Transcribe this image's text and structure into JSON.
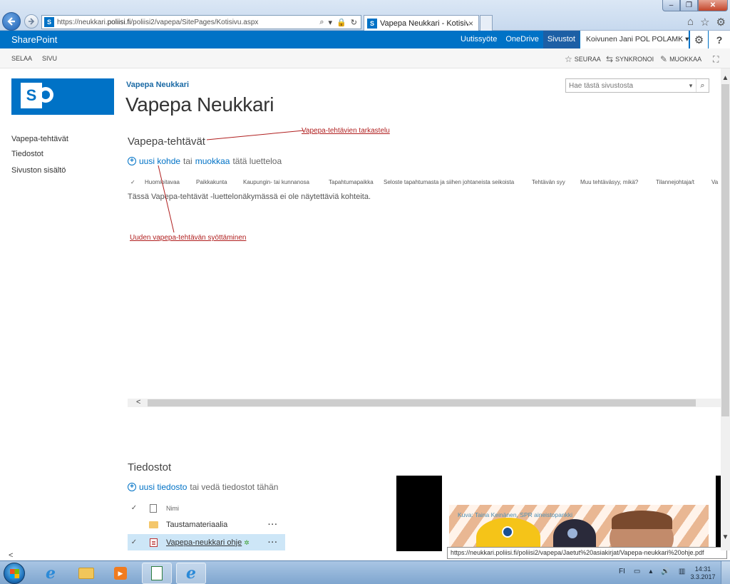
{
  "browser": {
    "url_prefix": "https://neukkari.",
    "url_domain": "poliisi.fi",
    "url_path": "/poliisi2/vapepa/SitePages/Kotisivu.aspx",
    "tab_title": "Vapepa Neukkari - Kotisivu",
    "tab_close": "×",
    "fav_letter": "S",
    "addr_icons": [
      "⌕",
      "▾",
      "🔒",
      "↻"
    ],
    "min_glyph": "–",
    "max_glyph": "❐",
    "close_glyph": "✕",
    "tools": [
      "⌂",
      "☆",
      "⚙"
    ]
  },
  "suite": {
    "brand": "SharePoint",
    "links": [
      "Uutissyöte",
      "OneDrive",
      "Sivustot"
    ],
    "active_link": "Sivustot",
    "user": "Koivunen Jani POL POLAMK ▾",
    "gear": "⚙",
    "help": "?"
  },
  "ribbon": {
    "tabs": [
      "SELAA",
      "SIVU"
    ],
    "follow": "SEURAA",
    "sync": "SYNKRONOI",
    "edit": "MUOKKAA",
    "follow_icon": "☆",
    "sync_icon": "⇆",
    "edit_icon": "✎",
    "focus_icon": "⛶"
  },
  "site": {
    "crumb": "Vapepa Neukkari",
    "title": "Vapepa Neukkari",
    "logo_letter": "S"
  },
  "search": {
    "placeholder": "Hae tästä sivustosta",
    "scope_icon": "▾",
    "button_icon": "⌕"
  },
  "quick_launch": [
    "Vapepa-tehtävät",
    "Tiedostot",
    "Sivuston sisältö"
  ],
  "tasks": {
    "heading": "Vapepa-tehtävät",
    "new_item": "uusi kohde",
    "or": "tai",
    "edit": "muokkaa",
    "edit_suffix": "tätä luetteloa",
    "columns": [
      "Huomioitavaa",
      "Paikkakunta",
      "Kaupungin- tai kunnanosa",
      "Tapahtumapaikka",
      "Seloste tapahtumasta ja siihen johtaneista seikoista",
      "Tehtävän syy",
      "Muu tehtäväsyy, mikä?",
      "Tilannejohtaja/t",
      "Va"
    ],
    "empty_message": "Tässä Vapepa-tehtävät -luettelonäkymässä ei ole näytettäviä kohteita.",
    "check_glyph": "✓"
  },
  "annotations": {
    "view_tasks": "Vapepa-tehtävien tarkastelu",
    "new_task": "Uuden vapepa-tehtävän syöttäminen"
  },
  "files": {
    "heading": "Tiedostot",
    "new_file": "uusi tiedosto",
    "or_drag": "tai vedä tiedostot tähän",
    "name_header": "Nimi",
    "rows": [
      {
        "name": "Taustamateriaalia",
        "type": "folder",
        "menu": "···"
      },
      {
        "name": "Vapepa-neukkari ohje",
        "type": "pdf",
        "menu": "···",
        "badge": "✲",
        "check": "✓"
      }
    ]
  },
  "image": {
    "caption": "Kuva: Taina Keinänen, SPR aineistopankki"
  },
  "status_url": "https://neukkari.poliisi.fi/poliisi2/vapepa/Jaetut%20asiakirjat/Vapepa-neukkari%20ohje.pdf",
  "scroll": {
    "left": "<",
    "up": "▲",
    "down": "▼"
  },
  "taskbar": {
    "lang": "FI",
    "tray_icons": [
      "▭",
      "▴",
      "🔊",
      "▥"
    ],
    "time": "14:31",
    "date": "3.3.2017",
    "media_glyph": "▶",
    "ie_glyph": "e"
  }
}
